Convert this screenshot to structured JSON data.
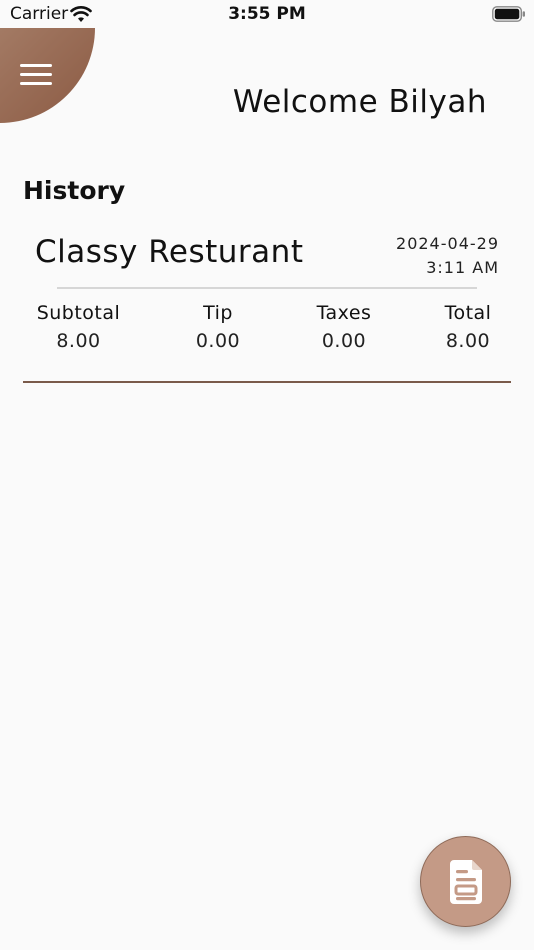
{
  "status_bar": {
    "carrier": "Carrier",
    "time": "3:55 PM",
    "icons": [
      "wifi-icon",
      "battery-icon"
    ]
  },
  "header": {
    "menu_icon": "hamburger-icon",
    "welcome": "Welcome Bilyah",
    "accent_color": "#9b6b53"
  },
  "history": {
    "heading": "History",
    "entries": [
      {
        "restaurant": "Classy Resturant",
        "date": "2024-04-29",
        "time": "3:11 AM",
        "subtotal_label": "Subtotal",
        "subtotal": "8.00",
        "tip_label": "Tip",
        "tip": "0.00",
        "taxes_label": "Taxes",
        "taxes": "0.00",
        "total_label": "Total",
        "total": "8.00"
      }
    ]
  },
  "fab": {
    "icon": "receipt-icon",
    "color": "#c49a86"
  }
}
